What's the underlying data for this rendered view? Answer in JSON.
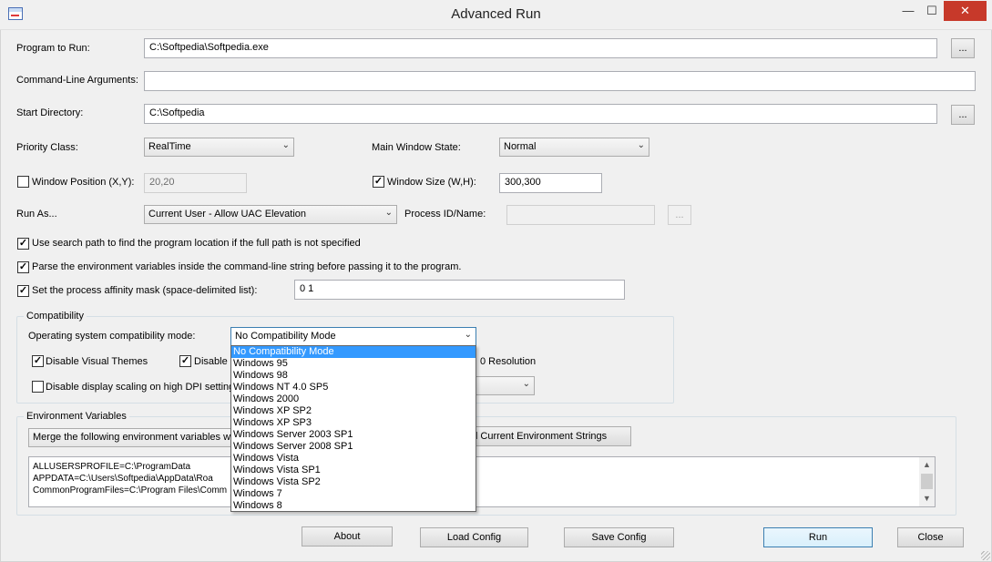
{
  "window": {
    "title": "Advanced Run",
    "min_glyph": "—",
    "max_glyph": "☐",
    "close_glyph": "✕"
  },
  "program_to_run": {
    "label": "Program to Run:",
    "value": "C:\\Softpedia\\Softpedia.exe",
    "browse": "..."
  },
  "command_line": {
    "label": "Command-Line Arguments:",
    "value": ""
  },
  "start_directory": {
    "label": "Start Directory:",
    "value": "C:\\Softpedia",
    "browse": "..."
  },
  "priority_class": {
    "label": "Priority Class:",
    "value": "RealTime"
  },
  "main_window_state": {
    "label": "Main Window State:",
    "value": "Normal"
  },
  "window_position": {
    "label": "Window Position (X,Y):",
    "checked": false,
    "value": "20,20"
  },
  "window_size": {
    "label": "Window Size (W,H):",
    "checked": true,
    "value": "300,300"
  },
  "run_as": {
    "label": "Run As...",
    "value": "Current User - Allow UAC Elevation"
  },
  "process_id": {
    "label": "Process ID/Name:",
    "value": "",
    "browse": "..."
  },
  "options": {
    "search_path": {
      "label": "Use search path to find the program location if the full path is not specified",
      "checked": true
    },
    "parse_env": {
      "label": "Parse the environment variables inside the command-line string before passing it to the program.",
      "checked": true
    },
    "affinity": {
      "label": "Set the process affinity mask (space-delimited list):",
      "checked": true,
      "value": "0 1"
    }
  },
  "compatibility": {
    "title": "Compatibility",
    "os_mode_label": "Operating system compatibility mode:",
    "os_mode_value": "No Compatibility Mode",
    "disable_visual_themes": {
      "label": "Disable Visual Themes",
      "checked": true
    },
    "disable_partial": {
      "label": "Disable",
      "checked": true
    },
    "resolution_partial": "0 Resolution",
    "disable_dpi_scaling": {
      "label": "Disable display scaling on high DPI settings",
      "checked": false
    }
  },
  "dropdown_options": [
    "No Compatibility Mode",
    "Windows 95",
    "Windows 98",
    "Windows NT 4.0 SP5",
    "Windows 2000",
    "Windows XP SP2",
    "Windows XP SP3",
    "Windows Server 2003 SP1",
    "Windows Server 2008 SP1",
    "Windows Vista",
    "Windows Vista SP1",
    "Windows Vista SP2",
    "Windows 7",
    "Windows 8"
  ],
  "environment": {
    "title": "Environment Variables",
    "merge_value": "Merge the following environment variables with",
    "fill_button": "ill Current Environment Strings",
    "lines": [
      "ALLUSERSPROFILE=C:\\ProgramData",
      "APPDATA=C:\\Users\\Softpedia\\AppData\\Roa",
      "CommonProgramFiles=C:\\Program Files\\Comm"
    ]
  },
  "buttons": {
    "about": "About",
    "load_config": "Load Config",
    "save_config": "Save Config",
    "run": "Run",
    "close": "Close"
  },
  "colors": {
    "selection": "#3399ff",
    "close_button": "#c7392a"
  }
}
